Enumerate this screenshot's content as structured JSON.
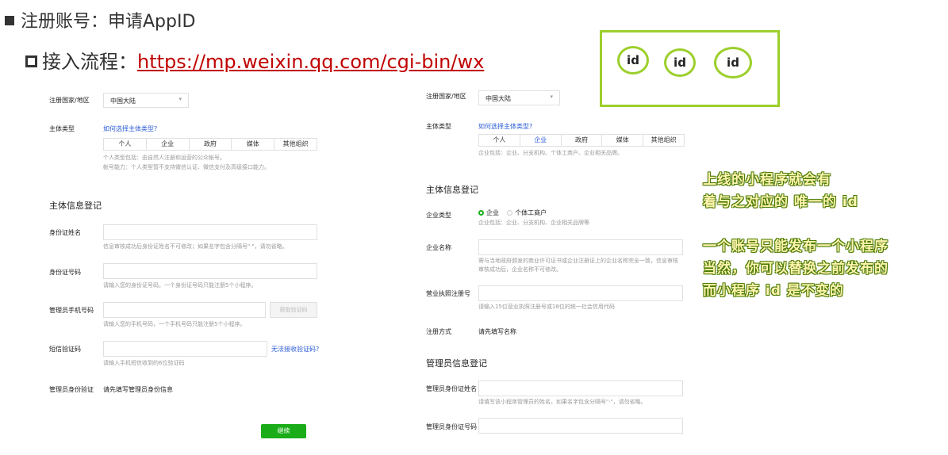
{
  "slide": {
    "heading": "注册账号：申请AppID",
    "subheading_label": "接入流程：",
    "subheading_link": "https://mp.weixin.qq.com/cgi-bin/wx"
  },
  "left_form": {
    "country_label": "注册国家/地区",
    "country_value": "中国大陆",
    "entity_type_label": "主体类型",
    "entity_type_link": "如何选择主体类型?",
    "entity_tabs": [
      "个人",
      "企业",
      "政府",
      "媒体",
      "其他组织"
    ],
    "entity_hint_1": "个人类型包括：由自然人注册和运营的公众帐号。",
    "entity_hint_2": "帐号能力：个人类型暂不支持微信认证、微信支付及高级接口能力。",
    "section_title": "主体信息登记",
    "id_name_label": "身份证姓名",
    "id_name_hint": "信息审核成功后身份证姓名不可修改；如果名字包含分隔号\"·\"，请勿省略。",
    "id_number_label": "身份证号码",
    "id_number_hint": "请输入您的身份证号码。一个身份证号码只能注册5个小程序。",
    "phone_label": "管理员手机号码",
    "phone_button": "获取验证码",
    "phone_hint": "请输入您的手机号码，一个手机号码只能注册5个小程序。",
    "sms_label": "短信验证码",
    "sms_link": "无法接收验证码?",
    "sms_hint": "请输入手机短信收到的6位验证码",
    "admin_verify_label": "管理员身份验证",
    "admin_verify_value": "请先填写管理员身份信息",
    "continue_button": "继续"
  },
  "right_form": {
    "country_label": "注册国家/地区",
    "country_value": "中国大陆",
    "entity_type_label": "主体类型",
    "entity_type_link": "如何选择主体类型?",
    "entity_tabs": [
      "个人",
      "企业",
      "政府",
      "媒体",
      "其他组织"
    ],
    "entity_hint": "企业包括：企业、分支机构、个体工商户、企业相关品牌。",
    "section_title": "主体信息登记",
    "company_type_label": "企业类型",
    "company_type_option_1": "企业",
    "company_type_option_2": "个体工商户",
    "company_type_hint": "企业包括：企业、分支机构、企业相关品牌等",
    "company_name_label": "企业名称",
    "company_name_hint_1": "需与当地政府颁发的商业许可证书或企业注册证上的企业名称完全一致，信息审核",
    "company_name_hint_2": "审核成功后，企业名称不可修改。",
    "license_label": "营业执照注册号",
    "license_hint": "请输入15位营业执照注册号或18位的统一社会信用代码",
    "reg_method_label": "注册方式",
    "reg_method_value": "请先填写名称",
    "admin_section_title": "管理员信息登记",
    "admin_name_label": "管理员身份证姓名",
    "admin_name_hint": "请填写该小程序管理员的姓名，如果名字包含分隔号\"·\"，请勿省略。",
    "admin_id_label": "管理员身份证号码"
  },
  "annotation": {
    "id_labels": [
      "id",
      "id",
      "id"
    ],
    "note_line_1": "上线的小程序就会有",
    "note_line_2": "着与之对应的 唯一的 id",
    "note_line_3": "一个账号只能发布一个小程序",
    "note_line_4": "当然，你可以替换之前发布的",
    "note_line_5": "而小程序 id 是不变的",
    "box_color": "#9ccf2b"
  },
  "colors": {
    "link_red": "#c00000",
    "link_blue": "#2a5bd7",
    "wechat_green": "#1aad19"
  }
}
